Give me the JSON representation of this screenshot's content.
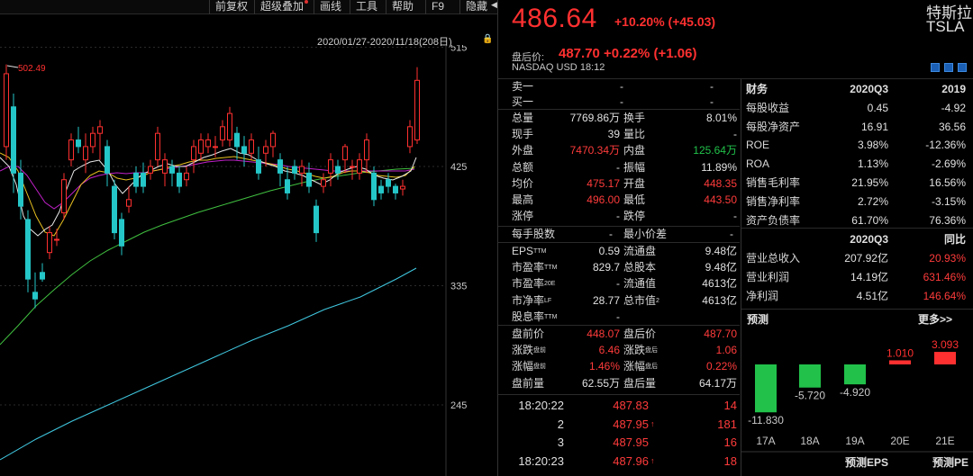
{
  "toolbar": {
    "items": [
      {
        "label": "前复权"
      },
      {
        "label": "超级叠加"
      },
      {
        "label": "画线"
      },
      {
        "label": "工具"
      },
      {
        "label": "帮助"
      },
      {
        "label": "F9"
      },
      {
        "label": "隐藏"
      }
    ]
  },
  "chart": {
    "date_range": "2020/01/27-2020/11/18(208日)",
    "high_marker": "502.49",
    "axis_ticks": [
      "515",
      "425",
      "335",
      "245"
    ]
  },
  "quote": {
    "price": "486.64",
    "change": "+10.20% (+45.03)",
    "name": "特斯拉",
    "ticker": "TSLA",
    "after_hours_label": "盘后价:",
    "after_hours": "487.70 +0.22% (+1.06)",
    "exchange": "NASDAQ",
    "currency": "USD",
    "time": "18:12"
  },
  "orderbook": [
    {
      "label": "卖一",
      "a": "-",
      "b": "-"
    },
    {
      "label": "买一",
      "a": "-",
      "b": "-"
    }
  ],
  "stats": [
    {
      "l1": "总量",
      "v1": "7769.86万",
      "c1": "wht",
      "l2": "换手",
      "v2": "8.01%",
      "c2": "wht"
    },
    {
      "l1": "现手",
      "v1": "39",
      "c1": "wht",
      "l2": "量比",
      "v2": "-",
      "c2": "wht"
    },
    {
      "l1": "外盘",
      "v1": "7470.34万",
      "c1": "red",
      "l2": "内盘",
      "v2": "125.64万",
      "c2": "grn"
    },
    {
      "l1": "总额",
      "v1": "-",
      "c1": "wht",
      "l2": "振幅",
      "v2": "11.89%",
      "c2": "wht"
    },
    {
      "l1": "均价",
      "v1": "475.17",
      "c1": "red",
      "l2": "开盘",
      "v2": "448.35",
      "c2": "red"
    },
    {
      "l1": "最高",
      "v1": "496.00",
      "c1": "red",
      "l2": "最低",
      "v2": "443.50",
      "c2": "red"
    },
    {
      "l1": "涨停",
      "v1": "-",
      "c1": "wht",
      "l2": "跌停",
      "v2": "-",
      "c2": "wht"
    }
  ],
  "per_lot": {
    "l1": "每手股数",
    "v1": "-",
    "l2": "最小价差",
    "v2": "-"
  },
  "valuation": [
    {
      "l1": "EPS",
      "s1": "TTM",
      "v1": "0.59",
      "l2": "流通盘",
      "s2": "",
      "v2": "9.48亿"
    },
    {
      "l1": "市盈率",
      "s1": "TTM",
      "v1": "829.7",
      "l2": "总股本",
      "s2": "",
      "v2": "9.48亿"
    },
    {
      "l1": "市盈率",
      "s1": "20E",
      "v1": "-",
      "l2": "流通值",
      "s2": "",
      "v2": "4613亿"
    },
    {
      "l1": "市净率",
      "s1": "LF",
      "v1": "28.77",
      "l2": "总市值",
      "s2": "2",
      "v2": "4613亿"
    },
    {
      "l1": "股息率",
      "s1": "TTM",
      "v1": "-",
      "l2": "",
      "s2": "",
      "v2": ""
    }
  ],
  "prepost": [
    {
      "l1": "盘前价",
      "s1": "",
      "v1": "448.07",
      "l2": "盘后价",
      "s2": "",
      "v2": "487.70"
    },
    {
      "l1": "涨跌",
      "s1": "盘前",
      "v1": "6.46",
      "l2": "涨跌",
      "s2": "盘后",
      "v2": "1.06"
    },
    {
      "l1": "涨幅",
      "s1": "盘前",
      "v1": "1.46%",
      "l2": "涨幅",
      "s2": "盘后",
      "v2": "0.22%"
    },
    {
      "l1": "盘前量",
      "s1": "",
      "v1": "62.55万",
      "l2": "盘后量",
      "s2": "",
      "v2": "64.17万"
    }
  ],
  "ticks": [
    {
      "time": "18:20:22",
      "price": "487.83",
      "arrow": "",
      "vol": "14"
    },
    {
      "time": "2",
      "price": "487.95",
      "arrow": "↑",
      "vol": "181"
    },
    {
      "time": "3",
      "price": "487.95",
      "arrow": "",
      "vol": "16"
    },
    {
      "time": "18:20:23",
      "price": "487.96",
      "arrow": "↑",
      "vol": "18"
    }
  ],
  "financial": {
    "header": [
      "财务",
      "2020Q3",
      "2019"
    ],
    "rows": [
      {
        "l": "每股收益",
        "a": "0.45",
        "b": "-4.92"
      },
      {
        "l": "每股净资产",
        "a": "16.91",
        "b": "36.56"
      },
      {
        "l": "ROE",
        "a": "3.98%",
        "b": "-12.36%"
      },
      {
        "l": "ROA",
        "a": "1.13%",
        "b": "-2.69%"
      },
      {
        "l": "销售毛利率",
        "a": "21.95%",
        "b": "16.56%"
      },
      {
        "l": "销售净利率",
        "a": "2.72%",
        "b": "-3.15%"
      },
      {
        "l": "资产负债率",
        "a": "61.70%",
        "b": "76.36%"
      }
    ]
  },
  "income": {
    "header": [
      "",
      "2020Q3",
      "同比"
    ],
    "rows": [
      {
        "l": "营业总收入",
        "a": "207.92亿",
        "b": "20.93%"
      },
      {
        "l": "营业利润",
        "a": "14.19亿",
        "b": "631.46%"
      },
      {
        "l": "净利润",
        "a": "4.51亿",
        "b": "146.64%"
      }
    ]
  },
  "forecast": {
    "title": "预测",
    "more": "更多>>",
    "footer_left": "预测EPS",
    "footer_right": "预测PE"
  },
  "chart_data": {
    "type": "bar",
    "categories": [
      "17A",
      "18A",
      "19A",
      "20E",
      "21E"
    ],
    "values": [
      -11.83,
      -5.72,
      -4.92,
      1.01,
      3.093
    ],
    "value_labels": [
      "-11.830",
      "-5.720",
      "-4.920",
      "1.010",
      "3.093"
    ],
    "colors": {
      "up": "#ff3030",
      "down": "#21c14a"
    }
  },
  "colors": {
    "up": "#ff3030",
    "down": "#25c6c8",
    "ma5": "#e8e8e8",
    "ma10": "#e8c020",
    "ma20": "#c020c8",
    "ma60": "#40c040",
    "ma250": "#40c8e0"
  }
}
